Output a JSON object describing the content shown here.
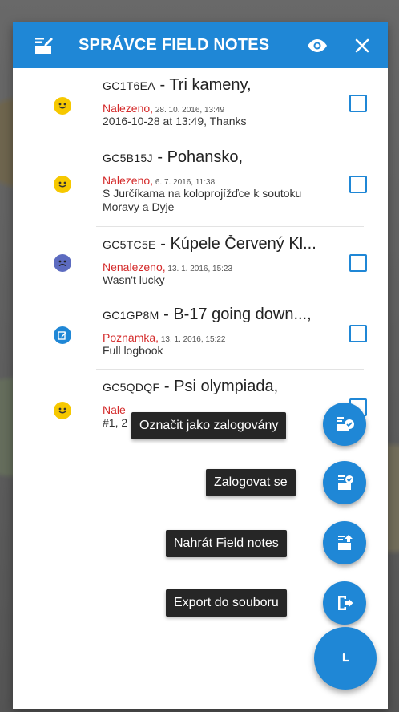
{
  "header": {
    "title": "SPRÁVCE FIELD NOTES",
    "app_icon": "field-notes-icon",
    "view_icon": "eye-icon",
    "close_icon": "close-icon"
  },
  "notes": [
    {
      "code": "GC1T6EA",
      "name": " - Tri kameny,",
      "state": "Nalezeno",
      "date": " 28. 10. 2016, 13:49",
      "text": "2016-10-28 at 13:49, Thanks",
      "icon": "smiley-found-icon"
    },
    {
      "code": "GC5B15J",
      "name": " - Pohansko,",
      "state": "Nalezeno",
      "date": " 6. 7. 2016, 11:38",
      "text": "S Jurčíkama na koloprojížďce k soutoku Moravy a Dyje",
      "icon": "smiley-found-icon"
    },
    {
      "code": "GC5TC5E",
      "name": " - Kúpele Červený Kl...",
      "state": "Nenalezeno",
      "date": " 13. 1. 2016, 15:23",
      "text": "Wasn't lucky",
      "icon": "sad-not-found-icon"
    },
    {
      "code": "GC1GP8M",
      "name": " - B-17 going down...,",
      "state": "Poznámka",
      "date": " 13. 1. 2016, 15:22",
      "text": "Full logbook",
      "icon": "note-icon"
    },
    {
      "code": "GC5QDQF",
      "name": " - Psi olympiada,",
      "state": "Nale",
      "date": "",
      "text": "#1, 2",
      "icon": "smiley-found-icon"
    }
  ],
  "fab_actions": {
    "mark_logged": "Označit jako zalogovány",
    "log_in": "Zalogovat se",
    "upload": "Nahrát Field notes",
    "export": "Export do souboru"
  },
  "colors": {
    "primary": "#1f87d6",
    "state_red": "#d42a2a",
    "smiley": "#f6c800",
    "sad": "#5c6bc0"
  }
}
